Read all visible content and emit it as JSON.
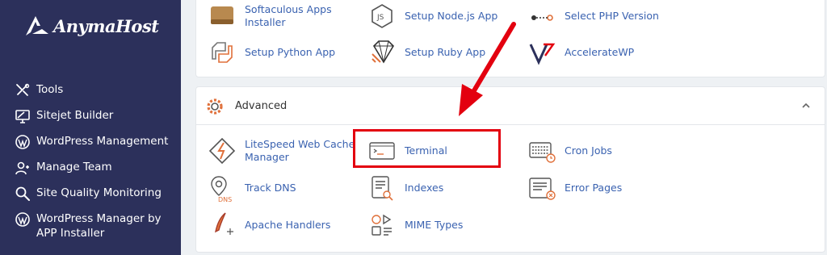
{
  "brand": {
    "name": "AnymaHost"
  },
  "sidebar": {
    "items": [
      {
        "label": "Tools",
        "icon": "tools-icon"
      },
      {
        "label": "Sitejet Builder",
        "icon": "monitor-icon"
      },
      {
        "label": "WordPress Management",
        "icon": "wordpress-icon"
      },
      {
        "label": "Manage Team",
        "icon": "users-icon"
      },
      {
        "label": "Site Quality Monitoring",
        "icon": "search-icon"
      },
      {
        "label": "WordPress Manager by APP Installer",
        "icon": "wordpress-icon"
      }
    ]
  },
  "software": {
    "items": [
      {
        "label": "Softaculous Apps Installer",
        "icon": "softaculous-icon"
      },
      {
        "label": "Setup Node.js App",
        "icon": "nodejs-icon"
      },
      {
        "label": "Select PHP Version",
        "icon": "php-version-icon"
      },
      {
        "label": "Setup Python App",
        "icon": "python-icon"
      },
      {
        "label": "Setup Ruby App",
        "icon": "ruby-icon"
      },
      {
        "label": "AccelerateWP",
        "icon": "acceleratewp-icon"
      }
    ]
  },
  "advanced": {
    "title": "Advanced",
    "items": [
      {
        "label": "LiteSpeed Web Cache Manager",
        "icon": "litespeed-icon"
      },
      {
        "label": "Terminal",
        "icon": "terminal-icon"
      },
      {
        "label": "Cron Jobs",
        "icon": "cron-icon"
      },
      {
        "label": "Track DNS",
        "icon": "dns-icon"
      },
      {
        "label": "Indexes",
        "icon": "indexes-icon"
      },
      {
        "label": "Error Pages",
        "icon": "error-pages-icon"
      },
      {
        "label": "Apache Handlers",
        "icon": "apache-icon"
      },
      {
        "label": "MIME Types",
        "icon": "mime-icon"
      }
    ],
    "dns_badge": "DNS"
  },
  "colors": {
    "sidebar": "#2c305b",
    "link": "#3a62b0",
    "highlight": "#e3000f",
    "accent": "#e0703a"
  }
}
